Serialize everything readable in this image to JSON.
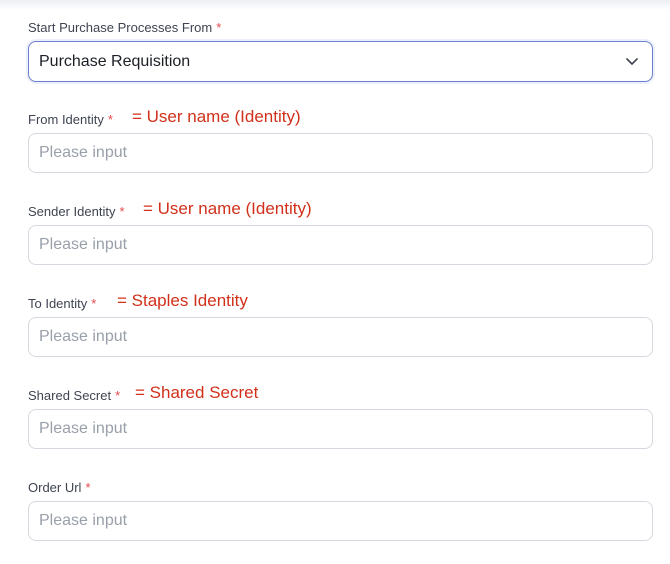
{
  "start_from": {
    "label": "Start Purchase Processes From",
    "required_mark": "*",
    "value": "Purchase Requisition"
  },
  "fields": [
    {
      "label": "From Identity",
      "required_mark": "*",
      "note": "= User name (Identity)",
      "placeholder": "Please input"
    },
    {
      "label": "Sender Identity",
      "required_mark": "*",
      "note": "= User name (Identity)",
      "placeholder": "Please input"
    },
    {
      "label": "To Identity",
      "required_mark": "*",
      "note": "= Staples Identity",
      "placeholder": "Please input"
    },
    {
      "label": "Shared Secret",
      "required_mark": "*",
      "note": "= Shared Secret",
      "placeholder": "Please input"
    },
    {
      "label": "Order Url",
      "required_mark": "*",
      "placeholder": "Please input"
    }
  ],
  "colors": {
    "required": "#e5484d",
    "annotation": "#d1301b",
    "focus_border": "#6a7fcf"
  }
}
